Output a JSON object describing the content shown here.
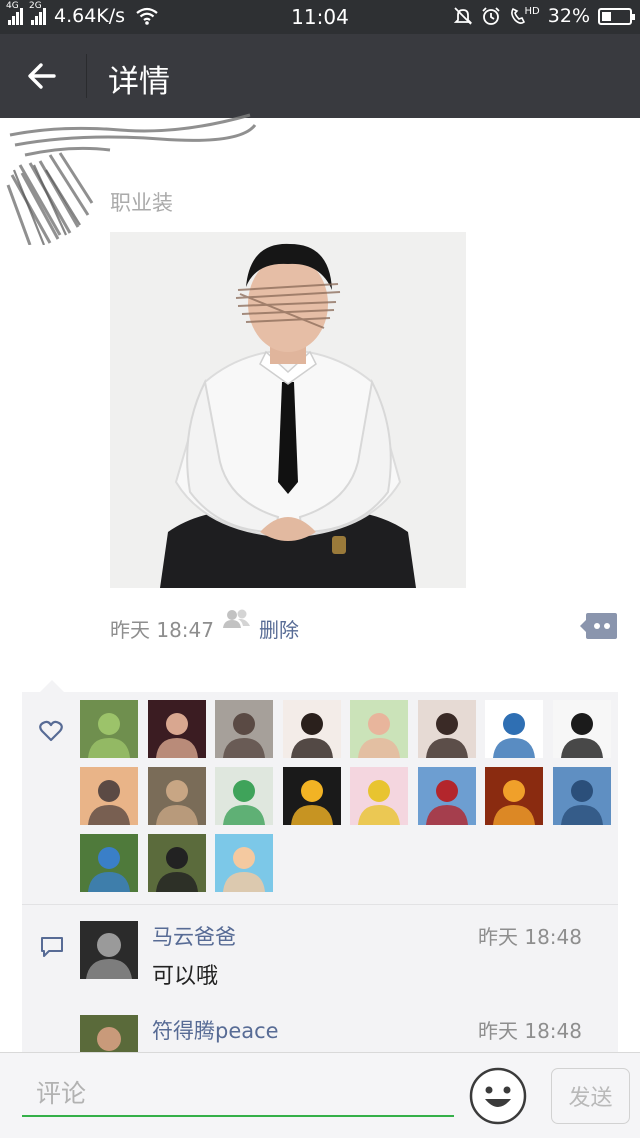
{
  "status_bar": {
    "net1": "4G",
    "net2": "2G",
    "speed": "4.64K/s",
    "time": "11:04",
    "hd": "HD",
    "battery": "32%",
    "battery_level": 0.32
  },
  "navbar": {
    "title": "详情"
  },
  "post": {
    "text": "职业装",
    "time": "昨天 18:47",
    "delete_label": "删除"
  },
  "likes": {
    "avatars": [
      {
        "name": "like-avatar-1",
        "bg": "#6f8f4e",
        "fg": "#9cc36a"
      },
      {
        "name": "like-avatar-2",
        "bg": "#3b1c22",
        "fg": "#d9a790"
      },
      {
        "name": "like-avatar-3",
        "bg": "#a6a09a",
        "fg": "#5a4a44"
      },
      {
        "name": "like-avatar-4",
        "bg": "#f3ece8",
        "fg": "#2a201c"
      },
      {
        "name": "like-avatar-5",
        "bg": "#cbe3b9",
        "fg": "#e8b59c"
      },
      {
        "name": "like-avatar-6",
        "bg": "#e6dad4",
        "fg": "#3a2a26"
      },
      {
        "name": "like-avatar-7",
        "bg": "#ffffff",
        "fg": "#2f6fb3"
      },
      {
        "name": "like-avatar-8",
        "bg": "#f7f7f7",
        "fg": "#1b1b1b"
      },
      {
        "name": "like-avatar-9",
        "bg": "#e9b488",
        "fg": "#5b4a44"
      },
      {
        "name": "like-avatar-10",
        "bg": "#7a6c58",
        "fg": "#c8a684"
      },
      {
        "name": "like-avatar-11",
        "bg": "#dfe7de",
        "fg": "#3fa35a"
      },
      {
        "name": "like-avatar-12",
        "bg": "#1a1a1a",
        "fg": "#f2b324"
      },
      {
        "name": "like-avatar-13",
        "bg": "#f4d6df",
        "fg": "#e8c430"
      },
      {
        "name": "like-avatar-14",
        "bg": "#6d9ed1",
        "fg": "#b3262c"
      },
      {
        "name": "like-avatar-15",
        "bg": "#8a2b10",
        "fg": "#f0a02a"
      },
      {
        "name": "like-avatar-16",
        "bg": "#5f8fc2",
        "fg": "#2b4f7a"
      },
      {
        "name": "like-avatar-17",
        "bg": "#4f7a3b",
        "fg": "#3a7fc8"
      },
      {
        "name": "like-avatar-18",
        "bg": "#5b6b3c",
        "fg": "#222222"
      },
      {
        "name": "like-avatar-19",
        "bg": "#7cc8e8",
        "fg": "#f4c9a0"
      }
    ]
  },
  "comments": [
    {
      "name": "马云爸爸",
      "time": "昨天 18:48",
      "text": "可以哦",
      "avatar_bg": "#2b2b2b",
      "avatar_fg": "#9a9a9a"
    },
    {
      "name": "符得腾peace",
      "time": "昨天 18:48",
      "text": "",
      "avatar_bg": "#5a6a3a",
      "avatar_fg": "#c99a7a"
    }
  ],
  "input": {
    "placeholder": "评论",
    "send_label": "发送"
  },
  "colors": {
    "navbar": "#393a3f",
    "link": "#576b95",
    "accent_green": "#35b049"
  }
}
